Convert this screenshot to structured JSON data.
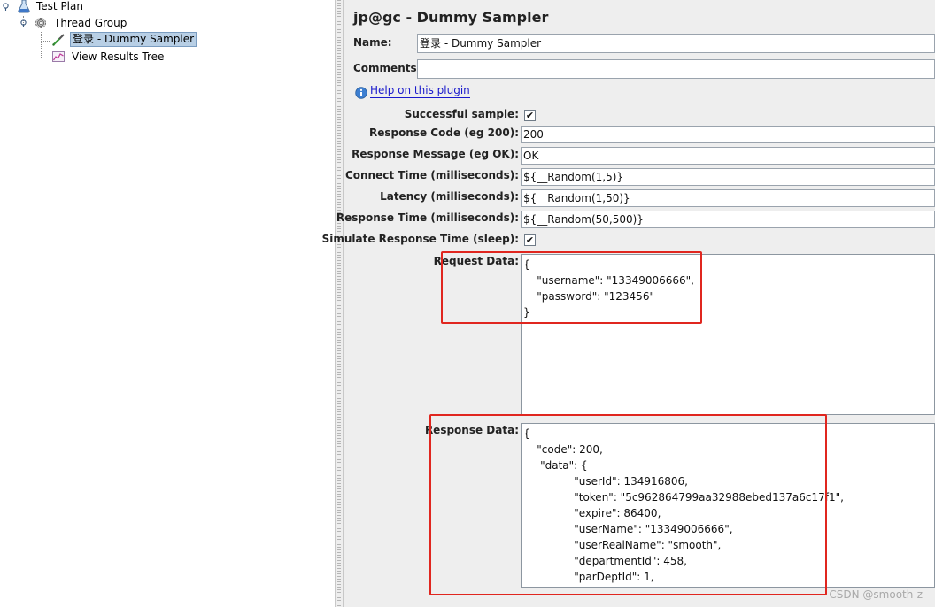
{
  "tree": {
    "items": [
      {
        "label": "Test Plan"
      },
      {
        "label": "Thread Group"
      },
      {
        "label": "登录 - Dummy Sampler"
      },
      {
        "label": "View Results Tree"
      }
    ]
  },
  "panel": {
    "title": "jp@gc - Dummy Sampler",
    "name_label": "Name:",
    "name_value": "登录 - Dummy Sampler",
    "comments_label": "Comments:",
    "comments_value": "",
    "help_link": "Help on this plugin",
    "successful_label": "Successful sample:",
    "successful_checked": "✔",
    "response_code_label": "Response Code (eg 200):",
    "response_code_value": "200",
    "response_message_label": "Response Message (eg OK):",
    "response_message_value": "OK",
    "connect_time_label": "Connect Time (milliseconds):",
    "connect_time_value": "${__Random(1,5)}",
    "latency_label": "Latency (milliseconds):",
    "latency_value": "${__Random(1,50)}",
    "response_time_label": "Response Time (milliseconds):",
    "response_time_value": "${__Random(50,500)}",
    "simulate_label": "Simulate Response Time (sleep):",
    "simulate_checked": "✔",
    "request_label": "Request Data:",
    "request_text": "{\n    \"username\": \"13349006666\",\n    \"password\": \"123456\"\n}",
    "response_label": "Response Data:",
    "response_text": "{\n    \"code\": 200,\n     \"data\": {\n               \"userId\": 134916806,\n               \"token\": \"5c962864799aa32988ebed137a6c17f1\",\n               \"expire\": 86400,\n               \"userName\": \"13349006666\",\n               \"userRealName\": \"smooth\",\n               \"departmentId\": 458,\n               \"parDeptId\": 1,"
  },
  "watermark": "CSDN @smooth-z",
  "colors": {
    "highlight_box": "#e0261f",
    "link": "#1a1acc",
    "selection": "#b8cfe5"
  }
}
